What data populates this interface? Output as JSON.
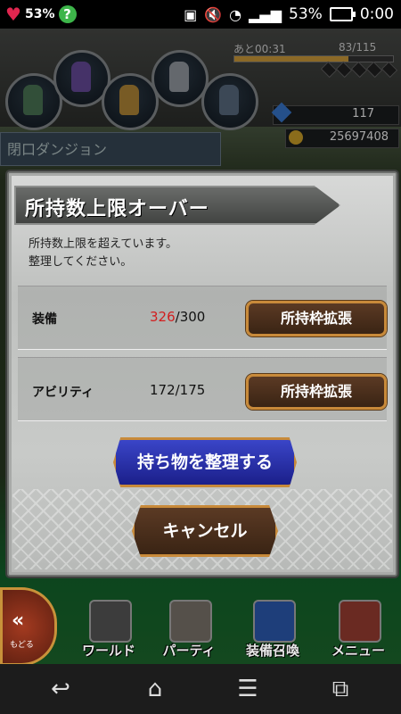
{
  "statusbar": {
    "left_battery_percent": "53%",
    "right_battery_percent": "53%",
    "time": "0:00"
  },
  "game": {
    "stamina": {
      "label": "あと00:31",
      "value": "83/115",
      "fraction": 0.72
    },
    "gems": "117",
    "gil": "25697408",
    "bg_panel_text": "閉口ダンジョン"
  },
  "dialog": {
    "title": "所持数上限オーバー",
    "message_line1": "所持数上限を超えています。",
    "message_line2": "整理してください。",
    "rows": [
      {
        "label": "装備",
        "count_over": "326",
        "count_rest": "/300",
        "button": "所持枠拡張"
      },
      {
        "label": "アビリティ",
        "count_over": "",
        "count_rest": "172/175",
        "button": "所持枠拡張"
      }
    ],
    "organize_button": "持ち物を整理する",
    "cancel_button": "キャンセル"
  },
  "game_nav": {
    "back_label": "もどる",
    "items": [
      {
        "label": "ワールド",
        "icon": "castle-icon"
      },
      {
        "label": "パーティ",
        "icon": "chess-pieces-icon"
      },
      {
        "label": "装備召喚",
        "icon": "summon-chest-icon"
      },
      {
        "label": "メニュー",
        "icon": "book-icon"
      }
    ]
  },
  "android_nav": {
    "back": "back-icon",
    "home": "home-icon",
    "menu": "menu-icon",
    "recents": "recents-icon"
  },
  "colors": {
    "accent_gold": "#c88a3a",
    "over_red": "#d21f1f",
    "primary_blue": "#2a33b0"
  }
}
